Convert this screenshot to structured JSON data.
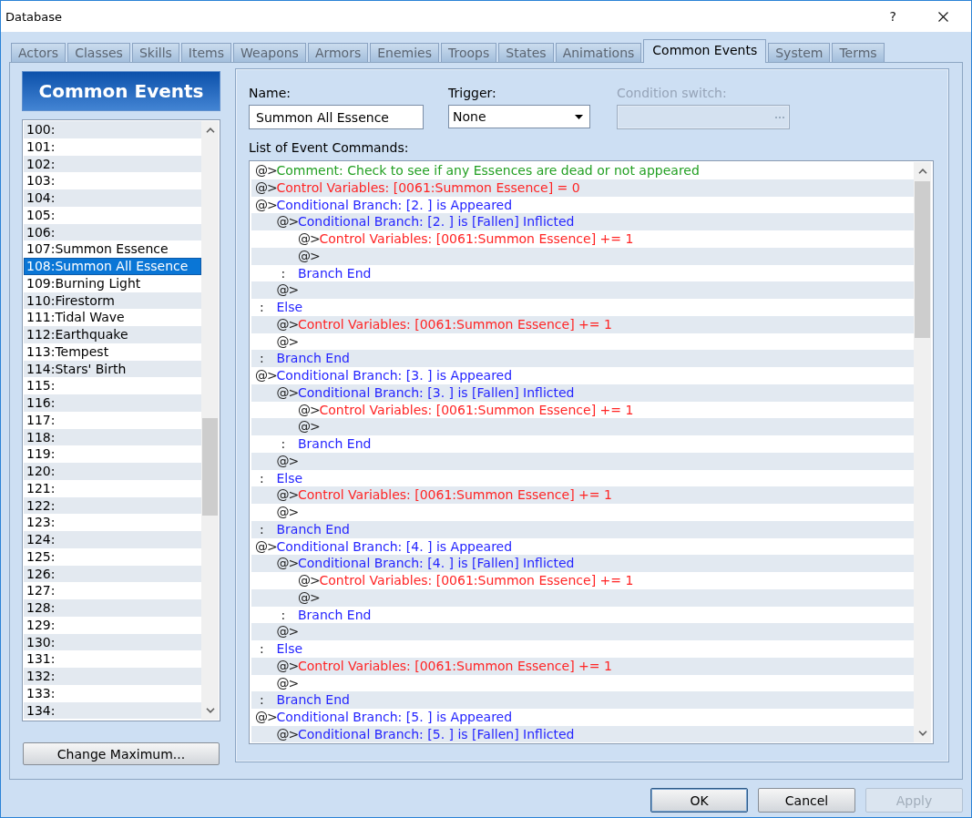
{
  "window": {
    "title": "Database",
    "help": "?"
  },
  "tabs": [
    {
      "label": "Actors",
      "selected": false
    },
    {
      "label": "Classes",
      "selected": false
    },
    {
      "label": "Skills",
      "selected": false
    },
    {
      "label": "Items",
      "selected": false
    },
    {
      "label": "Weapons",
      "selected": false
    },
    {
      "label": "Armors",
      "selected": false
    },
    {
      "label": "Enemies",
      "selected": false
    },
    {
      "label": "Troops",
      "selected": false
    },
    {
      "label": "States",
      "selected": false
    },
    {
      "label": "Animations",
      "selected": false
    },
    {
      "label": "Common Events",
      "selected": true
    },
    {
      "label": "System",
      "selected": false
    },
    {
      "label": "Terms",
      "selected": false
    }
  ],
  "event_list": {
    "title": "Common Events",
    "items": [
      {
        "label": "100:",
        "selected": false
      },
      {
        "label": "101:",
        "selected": false
      },
      {
        "label": "102:",
        "selected": false
      },
      {
        "label": "103:",
        "selected": false
      },
      {
        "label": "104:",
        "selected": false
      },
      {
        "label": "105:",
        "selected": false
      },
      {
        "label": "106:",
        "selected": false
      },
      {
        "label": "107:Summon Essence",
        "selected": false
      },
      {
        "label": "108:Summon All Essence",
        "selected": true
      },
      {
        "label": "109:Burning Light",
        "selected": false
      },
      {
        "label": "110:Firestorm",
        "selected": false
      },
      {
        "label": "111:Tidal Wave",
        "selected": false
      },
      {
        "label": "112:Earthquake",
        "selected": false
      },
      {
        "label": "113:Tempest",
        "selected": false
      },
      {
        "label": "114:Stars' Birth",
        "selected": false
      },
      {
        "label": "115:",
        "selected": false
      },
      {
        "label": "116:",
        "selected": false
      },
      {
        "label": "117:",
        "selected": false
      },
      {
        "label": "118:",
        "selected": false
      },
      {
        "label": "119:",
        "selected": false
      },
      {
        "label": "120:",
        "selected": false
      },
      {
        "label": "121:",
        "selected": false
      },
      {
        "label": "122:",
        "selected": false
      },
      {
        "label": "123:",
        "selected": false
      },
      {
        "label": "124:",
        "selected": false
      },
      {
        "label": "125:",
        "selected": false
      },
      {
        "label": "126:",
        "selected": false
      },
      {
        "label": "127:",
        "selected": false
      },
      {
        "label": "128:",
        "selected": false
      },
      {
        "label": "129:",
        "selected": false
      },
      {
        "label": "130:",
        "selected": false
      },
      {
        "label": "131:",
        "selected": false
      },
      {
        "label": "132:",
        "selected": false
      },
      {
        "label": "133:",
        "selected": false
      },
      {
        "label": "134:",
        "selected": false
      }
    ],
    "button": "Change Maximum..."
  },
  "form": {
    "name": {
      "label": "Name:",
      "value": "Summon All Essence"
    },
    "trigger": {
      "label": "Trigger:",
      "value": "None"
    },
    "condition_switch": {
      "label": "Condition switch:",
      "disabled": true
    },
    "commands_label": "List of Event Commands:",
    "commands": [
      {
        "kind": "comment",
        "prefix": "@>",
        "text": "Comment: Check to see if any Essences are dead or not appeared"
      },
      {
        "kind": "control",
        "prefix": "@>",
        "text": "Control Variables: [0061:Summon Essence] = 0"
      },
      {
        "kind": "branch",
        "prefix": "@>",
        "text": "Conditional Branch: [2. ] is Appeared",
        "children": [
          {
            "kind": "branch",
            "prefix": "@>",
            "text": "Conditional Branch: [2. ] is [Fallen] Inflicted",
            "children": [
              {
                "kind": "control",
                "prefix": "@>",
                "text": "Control Variables: [0061:Summon Essence] += 1"
              },
              {
                "kind": "empty",
                "prefix": "@>"
              }
            ]
          },
          {
            "kind": "clause",
            "prefix": ":",
            "text": "Branch End"
          },
          {
            "kind": "empty",
            "prefix": "@>"
          }
        ]
      },
      {
        "kind": "clause",
        "prefix": ":",
        "text": "Else",
        "children": [
          {
            "kind": "control",
            "prefix": "@>",
            "text": "Control Variables: [0061:Summon Essence] += 1"
          },
          {
            "kind": "empty",
            "prefix": "@>"
          }
        ]
      },
      {
        "kind": "clause",
        "prefix": ":",
        "text": "Branch End"
      },
      {
        "kind": "branch",
        "prefix": "@>",
        "text": "Conditional Branch: [3. ] is Appeared",
        "children": [
          {
            "kind": "branch",
            "prefix": "@>",
            "text": "Conditional Branch: [3. ] is [Fallen] Inflicted",
            "children": [
              {
                "kind": "control",
                "prefix": "@>",
                "text": "Control Variables: [0061:Summon Essence] += 1"
              },
              {
                "kind": "empty",
                "prefix": "@>"
              }
            ]
          },
          {
            "kind": "clause",
            "prefix": ":",
            "text": "Branch End"
          },
          {
            "kind": "empty",
            "prefix": "@>"
          }
        ]
      },
      {
        "kind": "clause",
        "prefix": ":",
        "text": "Else",
        "children": [
          {
            "kind": "control",
            "prefix": "@>",
            "text": "Control Variables: [0061:Summon Essence] += 1"
          },
          {
            "kind": "empty",
            "prefix": "@>"
          }
        ]
      },
      {
        "kind": "clause",
        "prefix": ":",
        "text": "Branch End"
      },
      {
        "kind": "branch",
        "prefix": "@>",
        "text": "Conditional Branch: [4. ] is Appeared",
        "children": [
          {
            "kind": "branch",
            "prefix": "@>",
            "text": "Conditional Branch: [4. ] is [Fallen] Inflicted",
            "children": [
              {
                "kind": "control",
                "prefix": "@>",
                "text": "Control Variables: [0061:Summon Essence] += 1"
              },
              {
                "kind": "empty",
                "prefix": "@>"
              }
            ]
          },
          {
            "kind": "clause",
            "prefix": ":",
            "text": "Branch End"
          },
          {
            "kind": "empty",
            "prefix": "@>"
          }
        ]
      },
      {
        "kind": "clause",
        "prefix": ":",
        "text": "Else",
        "children": [
          {
            "kind": "control",
            "prefix": "@>",
            "text": "Control Variables: [0061:Summon Essence] += 1"
          },
          {
            "kind": "empty",
            "prefix": "@>"
          }
        ]
      },
      {
        "kind": "clause",
        "prefix": ":",
        "text": "Branch End"
      },
      {
        "kind": "branch",
        "prefix": "@>",
        "text": "Conditional Branch: [5. ] is Appeared",
        "children": [
          {
            "kind": "branch",
            "prefix": "@>",
            "text": "Conditional Branch: [5. ] is [Fallen] Inflicted"
          }
        ]
      }
    ]
  },
  "buttons": [
    {
      "label": "OK",
      "default": true,
      "disabled": false
    },
    {
      "label": "Cancel",
      "default": false,
      "disabled": false
    },
    {
      "label": "Apply",
      "default": false,
      "disabled": true
    }
  ]
}
